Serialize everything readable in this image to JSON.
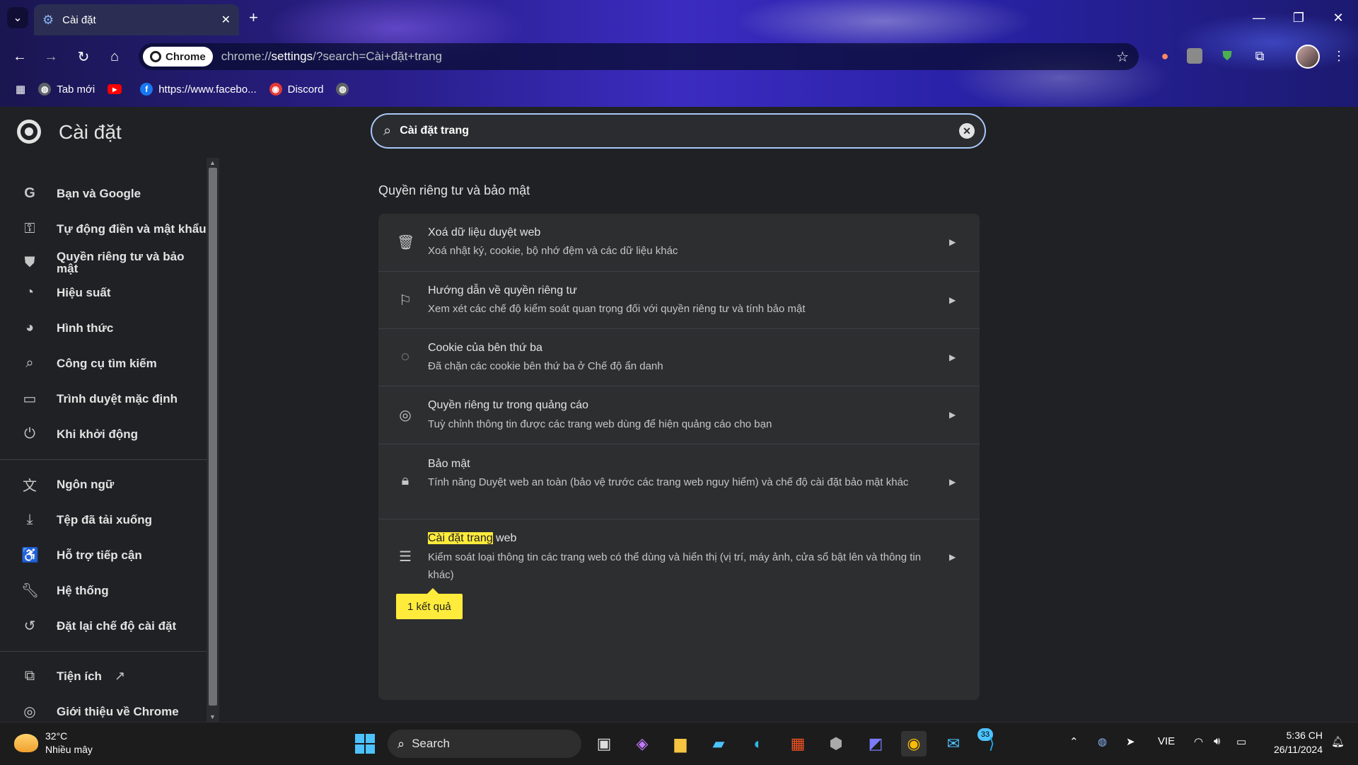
{
  "window": {
    "tab_title": "Cài đặt",
    "omnibox_chip": "Chrome",
    "url_prefix": "chrome://",
    "url_host": "settings",
    "url_rest": "/?search=Cài+đặt+trang"
  },
  "bookmarks": [
    {
      "label": "Tab mới",
      "icon": "globe-icon"
    },
    {
      "label": "",
      "icon": "youtube-icon"
    },
    {
      "label": "https://www.facebo...",
      "icon": "facebook-icon"
    },
    {
      "label": "Discord",
      "icon": "discord-icon"
    },
    {
      "label": "",
      "icon": "globe-icon"
    }
  ],
  "settings": {
    "title": "Cài đặt",
    "search_value": "Cài đặt trang"
  },
  "sidebar": {
    "items": [
      {
        "label": "Bạn và Google",
        "icon": "google-icon"
      },
      {
        "label": "Tự động điền và mật khẩu",
        "icon": "key-icon"
      },
      {
        "label": "Quyền riêng tư và bảo mật",
        "icon": "shield-icon"
      },
      {
        "label": "Hiệu suất",
        "icon": "speedometer-icon"
      },
      {
        "label": "Hình thức",
        "icon": "palette-icon"
      },
      {
        "label": "Công cụ tìm kiếm",
        "icon": "search-icon"
      },
      {
        "label": "Trình duyệt mặc định",
        "icon": "browser-window-icon"
      },
      {
        "label": "Khi khởi động",
        "icon": "power-icon"
      },
      {
        "label": "Ngôn ngữ",
        "icon": "translate-icon"
      },
      {
        "label": "Tệp đã tải xuống",
        "icon": "download-icon"
      },
      {
        "label": "Hỗ trợ tiếp cận",
        "icon": "accessibility-icon"
      },
      {
        "label": "Hệ thống",
        "icon": "wrench-icon"
      },
      {
        "label": "Đặt lại chế độ cài đặt",
        "icon": "reset-icon"
      },
      {
        "label": "Tiện ích",
        "icon": "puzzle-icon"
      },
      {
        "label": "Giới thiệu về Chrome",
        "icon": "chrome-icon"
      }
    ]
  },
  "section": {
    "title": "Quyền riêng tư và bảo mật",
    "rows": [
      {
        "title": "Xoá dữ liệu duyệt web",
        "subtitle": "Xoá nhật ký, cookie, bộ nhớ đệm và các dữ liệu khác",
        "icon": "trash-icon"
      },
      {
        "title": "Hướng dẫn về quyền riêng tư",
        "subtitle": "Xem xét các chế độ kiểm soát quan trọng đối với quyền riêng tư và tính bảo mật",
        "icon": "signpost-icon"
      },
      {
        "title": "Cookie của bên thứ ba",
        "subtitle": "Đã chặn các cookie bên thứ ba ở Chế độ ẩn danh",
        "icon": "cookie-icon"
      },
      {
        "title": "Quyền riêng tư trong quảng cáo",
        "subtitle": "Tuỳ chỉnh thông tin được các trang web dùng để hiện quảng cáo cho bạn",
        "icon": "ad-privacy-icon"
      },
      {
        "title": "Bảo mật",
        "subtitle": "Tính năng Duyệt web an toàn (bảo vệ trước các trang web nguy hiểm) và chế độ cài đặt bảo mật khác",
        "icon": "lock-icon"
      },
      {
        "title_highlight": "Cài đặt trang",
        "title_rest": " web",
        "subtitle": "Kiểm soát loại thông tin các trang web có thể dùng và hiển thị (vị trí, máy ảnh, cửa sổ bật lên và thông tin khác)",
        "icon": "tune-icon"
      }
    ],
    "result_bubble": "1 kết quả"
  },
  "taskbar": {
    "weather_temp": "32°C",
    "weather_desc": "Nhiều mây",
    "search_label": "Search",
    "badge_count": "33",
    "language": "VIE",
    "time": "5:36 CH",
    "date": "26/11/2024"
  },
  "colors": {
    "accent": "#a8c7fa",
    "highlight": "#ffeb3b",
    "background": "#202124",
    "card": "#2d2e30"
  }
}
